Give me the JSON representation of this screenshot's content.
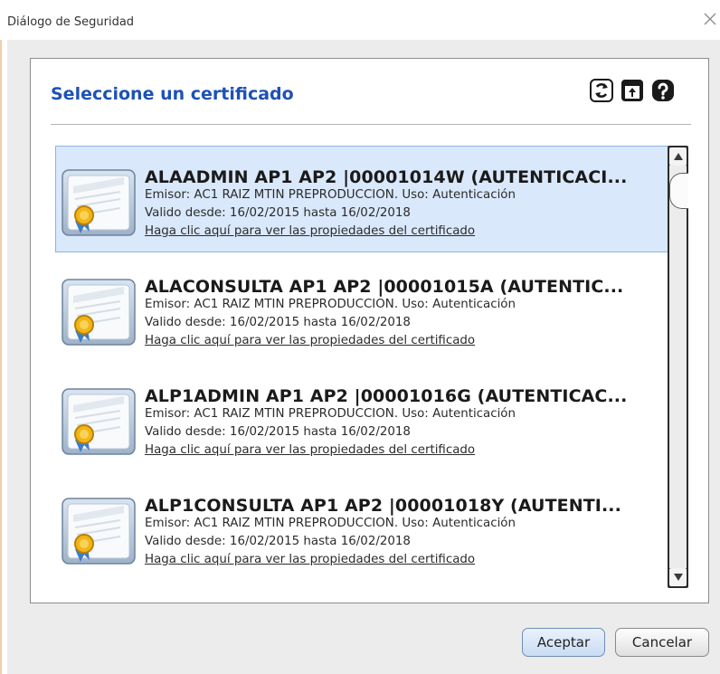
{
  "window": {
    "title": "Diálogo de Seguridad"
  },
  "panel": {
    "title": "Seleccione un certificado",
    "header_icons": [
      "refresh-icon",
      "open-file-icon",
      "help-icon"
    ]
  },
  "certificates": [
    {
      "name": "ALAADMIN AP1 AP2 |00001014W (AUTENTICACI...",
      "issuer_line": "Emisor: AC1 RAIZ MTIN PREPRODUCCION. Uso: Autenticación",
      "validity_line": "Valido desde: 16/02/2015 hasta 16/02/2018",
      "link": "Haga clic aquí para ver las propiedades del certificado",
      "selected": true
    },
    {
      "name": "ALACONSULTA AP1 AP2 |00001015A (AUTENTIC...",
      "issuer_line": "Emisor: AC1 RAIZ MTIN PREPRODUCCION. Uso: Autenticación",
      "validity_line": "Valido desde: 16/02/2015 hasta 16/02/2018",
      "link": "Haga clic aquí para ver las propiedades del certificado",
      "selected": false
    },
    {
      "name": "ALP1ADMIN AP1 AP2 |00001016G (AUTENTICAC...",
      "issuer_line": "Emisor: AC1 RAIZ MTIN PREPRODUCCION. Uso: Autenticación",
      "validity_line": "Valido desde: 16/02/2015 hasta 16/02/2018",
      "link": "Haga clic aquí para ver las propiedades del certificado",
      "selected": false
    },
    {
      "name": "ALP1CONSULTA AP1 AP2 |00001018Y (AUTENTI...",
      "issuer_line": "Emisor: AC1 RAIZ MTIN PREPRODUCCION. Uso: Autenticación",
      "validity_line": "Valido desde: 16/02/2015 hasta 16/02/2018",
      "link": "Haga clic aquí para ver las propiedades del certificado",
      "selected": false
    }
  ],
  "buttons": {
    "accept": "Aceptar",
    "cancel": "Cancelar"
  },
  "colors": {
    "title_blue": "#1d52b5",
    "selected_row": "#d9e8fb"
  }
}
